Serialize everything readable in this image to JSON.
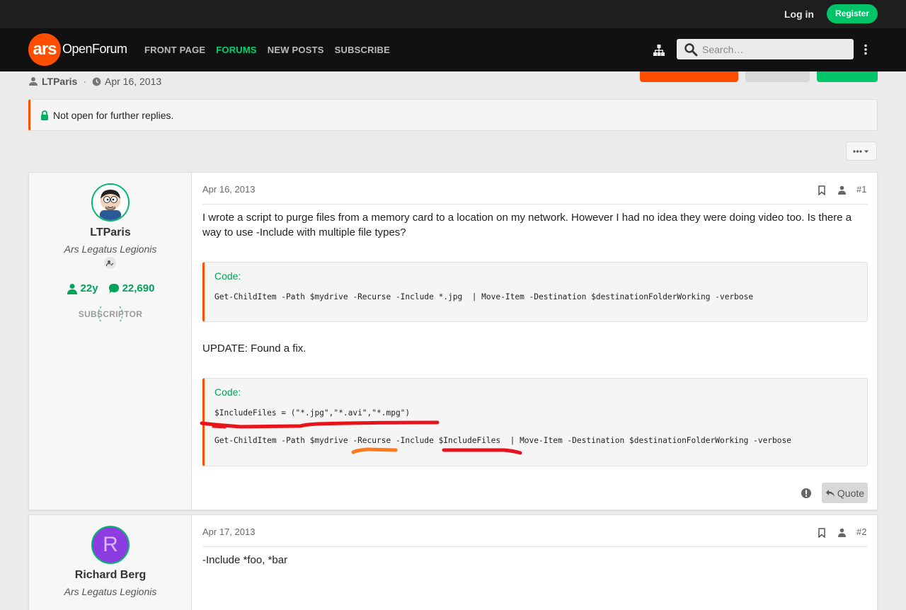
{
  "topbar": {
    "login_label": "Log in",
    "register_label": "Register"
  },
  "navbar": {
    "logo_mark": "ars",
    "logo_text": "OpenForum",
    "links": [
      "FRONT PAGE",
      "FORUMS",
      "NEW POSTS",
      "SUBSCRIBE"
    ],
    "active_link": "FORUMS",
    "search_placeholder": "Search…",
    "icons": [
      "sitemap-icon",
      "search-icon",
      "more-vertical-icon"
    ]
  },
  "thread": {
    "author": "LTParis",
    "date": "Apr 16, 2013",
    "notice": "Not open for further replies.",
    "tools_icon": "ellipsis-icon"
  },
  "posts": [
    {
      "username": "LTParis",
      "usertitle": "Ars Legatus Legionis",
      "tenure": "22y",
      "message_count": "22,690",
      "badge": "SUBSCRIPTOR",
      "date": "Apr 16, 2013",
      "number": "#1",
      "text1": "I wrote a script to purge files from a memory card to a location on my network. However I had no idea they were doing video too. Is there a way to use -Include with multiple file types?",
      "code_label": "Code:",
      "code1": "Get-ChildItem -Path $mydrive -Recurse -Include *.jpg  | Move-Item -Destination $destinationFolderWorking -verbose",
      "text2": "UPDATE: Found a fix.",
      "code2_line1": "$IncludeFiles = (\"*.jpg\",\"*.avi\",\"*.mpg\")",
      "code2_line2": "Get-ChildItem -Path $mydrive -Recurse -Include $IncludeFiles  | Move-Item -Destination $destinationFolderWorking -verbose",
      "quote_label": "Quote"
    },
    {
      "username": "Richard Berg",
      "avatar_letter": "R",
      "usertitle": "Ars Legatus Legionis",
      "date": "Apr 17, 2013",
      "number": "#2",
      "text1": "-Include *foo, *bar"
    }
  ],
  "colors": {
    "accent_green": "#00c468",
    "accent_orange": "#ff4e00",
    "annotation_red": "#e8141c",
    "annotation_orange": "#ff7a1a"
  }
}
